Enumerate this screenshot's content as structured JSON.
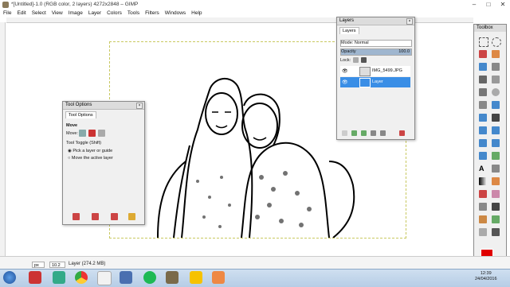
{
  "window": {
    "title": "*[Untitled]-1.0 (RGB color, 2 layers) 4272x2848 – GIMP"
  },
  "menu": [
    "File",
    "Edit",
    "Select",
    "View",
    "Image",
    "Layer",
    "Colors",
    "Tools",
    "Filters",
    "Windows",
    "Help"
  ],
  "status": {
    "unit": "px",
    "zoom": "10.2 %",
    "text": "Layer (274.2 MB)"
  },
  "tool_options": {
    "title": "Tool Options",
    "tab": "Tool Options",
    "tool_name": "Move",
    "move_label": "Move:",
    "toggle_label": "Tool Toggle  (Shift)",
    "radio_pick": "Pick a layer or guide",
    "radio_move_active": "Move the active layer"
  },
  "layers": {
    "title": "Layers",
    "tab": "Layers",
    "mode": "Mode: Normal",
    "opacity_label": "Opacity",
    "opacity_value": "100.0",
    "lock_label": "Lock:",
    "items": [
      {
        "name": "IMG_5499.JPG",
        "selected": false
      },
      {
        "name": "Layer",
        "selected": true
      }
    ]
  },
  "toolbox": {
    "title": "Toolbox"
  },
  "clock": {
    "time": "12:39",
    "date": "24/04/2016"
  },
  "colors": {
    "selection": "#3a8ee6",
    "fg": "#e00000",
    "bg": "#111111"
  }
}
